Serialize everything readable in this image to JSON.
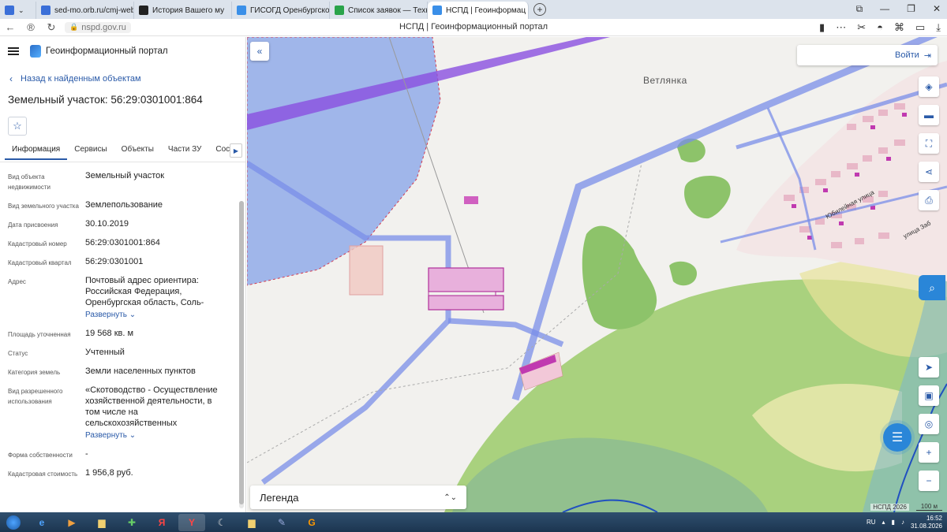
{
  "browser": {
    "tabs": [
      {
        "label": "sed-mo.orb.ru/cmj-web/?",
        "color": "#3a6fd8",
        "active": false
      },
      {
        "label": "История Вашего му",
        "color": "#222222",
        "active": false
      },
      {
        "label": "ГИСОГД Оренбургской о",
        "color": "#3a8fe8",
        "active": false
      },
      {
        "label": "Список заявок — ТехноК",
        "color": "#2aa44a",
        "active": false
      },
      {
        "label": "НСПД | Геоинформац",
        "color": "#3a8fe8",
        "active": true
      }
    ],
    "new_tab": "+",
    "url": "nspd.gov.ru",
    "page_title": "НСПД | Геоинформационный портал"
  },
  "panel": {
    "portal_name": "Геоинформационный портал",
    "back_label": "Назад к найденным объектам",
    "object_title": "Земельный участок: 56:29:0301001:864",
    "tabs": [
      {
        "label": "Информация",
        "active": true
      },
      {
        "label": "Сервисы",
        "active": false
      },
      {
        "label": "Объекты",
        "active": false
      },
      {
        "label": "Части ЗУ",
        "active": false
      },
      {
        "label": "Состав",
        "active": false
      }
    ],
    "properties": [
      {
        "key": "Вид объекта недвижимости",
        "value": "Земельный участок",
        "expand": ""
      },
      {
        "key": "Вид земельного участка",
        "value": "Землепользование",
        "expand": ""
      },
      {
        "key": "Дата присвоения",
        "value": "30.10.2019",
        "expand": ""
      },
      {
        "key": "Кадастровый номер",
        "value": "56:29:0301001:864",
        "expand": ""
      },
      {
        "key": "Кадастровый квартал",
        "value": "56:29:0301001",
        "expand": ""
      },
      {
        "key": "Адрес",
        "value": "Почтовый адрес ориентира: Российская Федерация, Оренбургская область, Соль-",
        "expand": "Развернуть"
      },
      {
        "key": "Площадь уточненная",
        "value": "19 568 кв. м",
        "expand": ""
      },
      {
        "key": "Статус",
        "value": "Учтенный",
        "expand": ""
      },
      {
        "key": "Категория земель",
        "value": "Земли населенных пунктов",
        "expand": ""
      },
      {
        "key": "Вид разрешенного использования",
        "value": "«Скотоводство - Осуществление хозяйственной деятельности, в том числе на сельскохозяйственных",
        "expand": "Развернуть"
      },
      {
        "key": "Форма собственности",
        "value": "-",
        "expand": ""
      },
      {
        "key": "Кадастровая стоимость",
        "value": "1 956,8 руб.",
        "expand": ""
      }
    ]
  },
  "map": {
    "login_label": "Войти",
    "village_label": "Ветлянка",
    "street_1": "Юбилейная улица",
    "street_2": "улица Заб",
    "legend_label": "Легенда",
    "copyright": "НСПД 2026",
    "scale": "100 м",
    "colors": {
      "parcel": "#c03ab0",
      "zone": "#7a8ee8",
      "green": "#8dc36a"
    }
  },
  "taskbar": {
    "lang": "RU",
    "time": "16:52",
    "date": "31.08.2026"
  }
}
